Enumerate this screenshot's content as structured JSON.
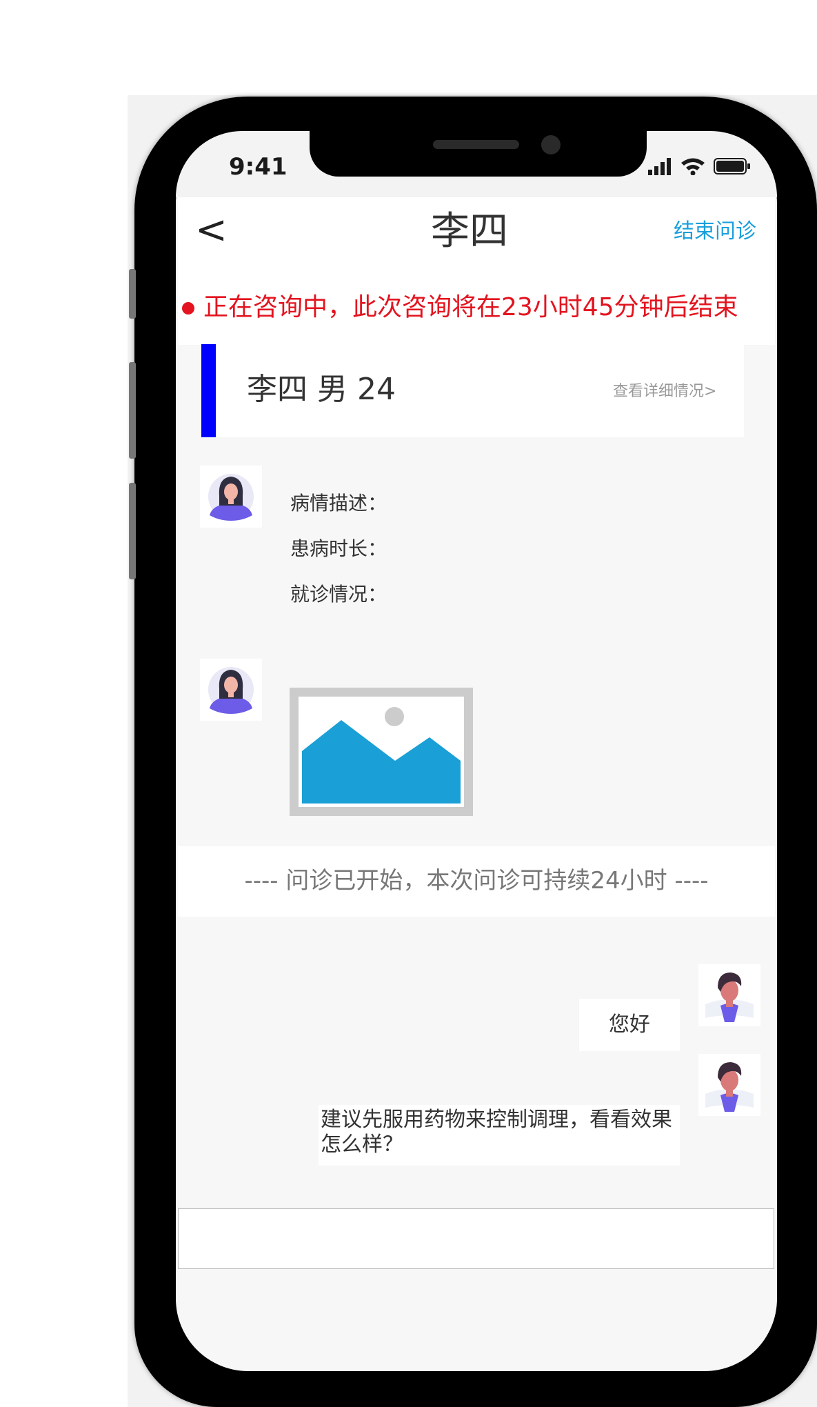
{
  "status_bar": {
    "time": "9:41"
  },
  "header": {
    "back_label": "<",
    "title": "李四",
    "end_button": "结束问诊"
  },
  "banner": {
    "text": "正在咨询中，此次咨询将在23小时45分钟后结束"
  },
  "patient_card": {
    "info": "李四 男 24",
    "detail_link": "查看详细情况>"
  },
  "patient_message": {
    "fields": [
      "病情描述：",
      "患病时长：",
      "就诊情况："
    ]
  },
  "divider": {
    "text": "---- 问诊已开始，本次问诊可持续24小时 ----"
  },
  "doctor_messages": [
    {
      "text": "您好"
    },
    {
      "text": "建议先服用药物来控制调理，看看效果怎么样？"
    }
  ],
  "colors": {
    "accent_blue": "#1a9fdc",
    "alert_red": "#e3141f",
    "card_bar": "#0000ff",
    "image_blue": "#1a9fd6"
  },
  "icons": [
    "back-arrow",
    "patient-avatar-icon",
    "doctor-avatar-icon",
    "image-placeholder-icon",
    "signal-icon",
    "wifi-icon",
    "battery-icon"
  ]
}
